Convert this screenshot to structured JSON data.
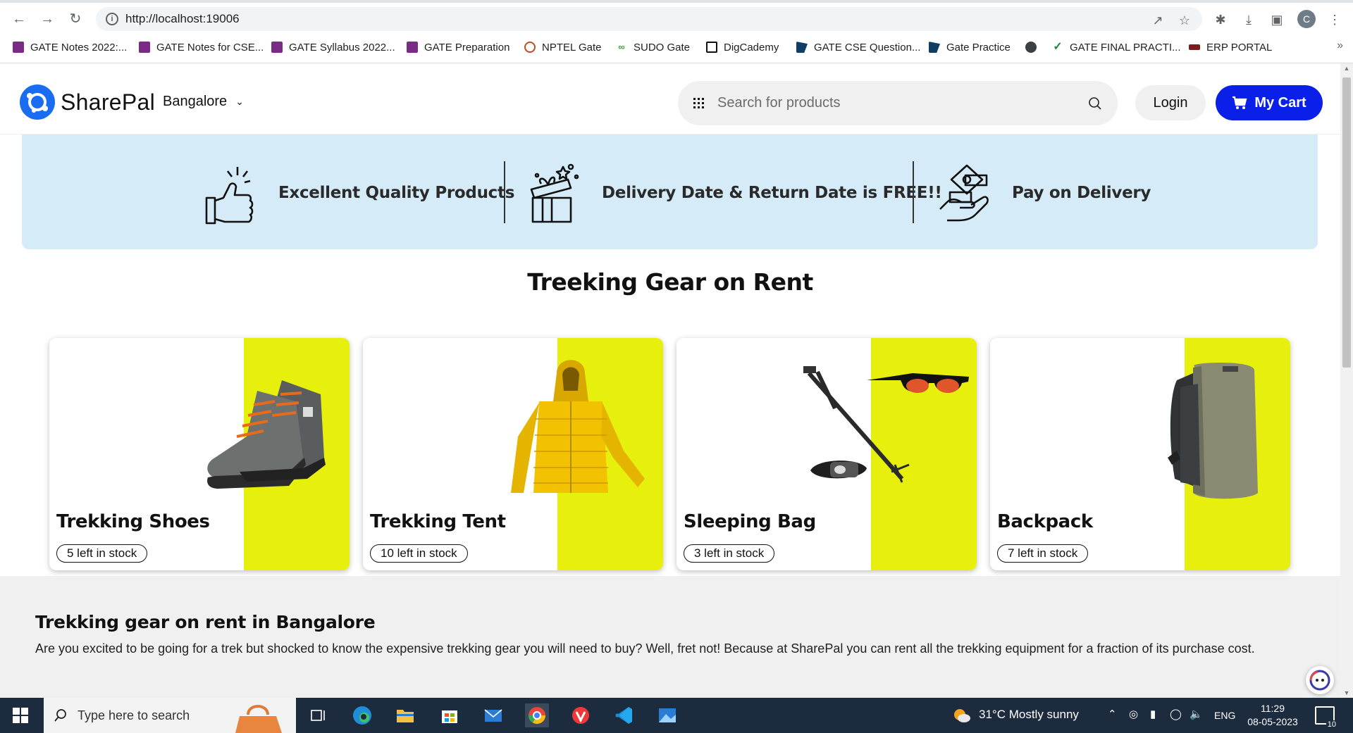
{
  "browser": {
    "url": "http://localhost:19006",
    "profile_initial": "C",
    "bookmarks": [
      {
        "label": "GATE Notes 2022:...",
        "icon": "b"
      },
      {
        "label": "GATE Notes for CSE...",
        "icon": "b"
      },
      {
        "label": "GATE Syllabus 2022...",
        "icon": "b"
      },
      {
        "label": "GATE Preparation",
        "icon": "b"
      },
      {
        "label": "NPTEL Gate",
        "icon": "n"
      },
      {
        "label": "SUDO Gate",
        "icon": "s"
      },
      {
        "label": "DigCademy",
        "icon": "d"
      },
      {
        "label": "GATE CSE Question...",
        "icon": "g"
      },
      {
        "label": "Gate Practice",
        "icon": "g"
      },
      {
        "label": "",
        "icon": "w"
      },
      {
        "label": "GATE FINAL PRACTI...",
        "icon": "c"
      },
      {
        "label": "ERP PORTAL",
        "icon": "e"
      }
    ]
  },
  "header": {
    "brand": "SharePal",
    "city": "Bangalore",
    "search_placeholder": "Search for products",
    "login_label": "Login",
    "cart_label": "My Cart",
    "accent_color": "#0a20e8"
  },
  "features": [
    {
      "label": "Excellent Quality Products",
      "icon": "thumbs-up-icon"
    },
    {
      "label": "Delivery Date & Return Date is FREE!!",
      "icon": "gift-box-icon"
    },
    {
      "label": "Pay on Delivery",
      "icon": "cash-in-hand-icon"
    }
  ],
  "section_title": "Treeking Gear on Rent",
  "products": [
    {
      "name": "Trekking Shoes",
      "stock": "5 left in stock",
      "icon": "hiking-boot-icon"
    },
    {
      "name": "Trekking Tent",
      "stock": "10 left in stock",
      "icon": "down-jacket-icon"
    },
    {
      "name": "Sleeping Bag",
      "stock": "3 left in stock",
      "icon": "sunglasses-poles-headlamp-icon"
    },
    {
      "name": "Backpack",
      "stock": "7 left in stock",
      "icon": "backpack-icon"
    }
  ],
  "info": {
    "title": "Trekking gear on rent in Bangalore",
    "text": "Are you excited to be going for a trek but shocked to know the expensive trekking gear you will need to buy? Well, fret not! Because at SharePal you can rent all the trekking equipment for a fraction of its purchase cost."
  },
  "taskbar": {
    "search_placeholder": "Type here to search",
    "weather": "31°C  Mostly sunny",
    "language": "ENG",
    "time": "11:29",
    "date": "08-05-2023",
    "notification_count": "10"
  }
}
